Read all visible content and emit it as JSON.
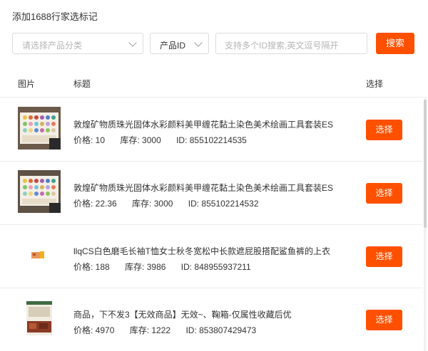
{
  "page_title": "添加1688行家选标记",
  "filters": {
    "category_placeholder": "请选择产品分类",
    "id_type_value": "产品ID",
    "search_placeholder": "支持多个ID搜索,英文逗号隔开",
    "search_button": "搜索"
  },
  "table": {
    "headers": {
      "image": "图片",
      "title": "标题",
      "action": "选择"
    },
    "rows": [
      {
        "title": "敦煌矿物质珠光固体水彩颜料美甲缠花黏土染色美术绘画工具套装ES",
        "price": "价格:  10",
        "stock": "库存:  3000",
        "id": "ID:  855102214535",
        "button": "选择",
        "thumb_icon": "watercolor-set-thumbnail"
      },
      {
        "title": "敦煌矿物质珠光固体水彩颜料美甲缠花黏土染色美术绘画工具套装ES",
        "price": "价格:  22.36",
        "stock": "库存:  3000",
        "id": "ID:  855102214532",
        "button": "选择",
        "thumb_icon": "watercolor-set-thumbnail"
      },
      {
        "title": "llqCS白色磨毛长袖T恤女士秋冬宽松中长款遮屁股搭配鲨鱼裤的上衣",
        "price": "价格:  188",
        "stock": "库存:  3986",
        "id": "ID:  848955937211",
        "button": "选择",
        "thumb_icon": "small-product-thumbnail"
      },
      {
        "title": "商品，下不发3【无效商品】无效~、鞠箱-仅属性收藏后优",
        "price": "价格:  4970",
        "stock": "库存:  1222",
        "id": "ID:  853807429473",
        "button": "选择",
        "thumb_icon": "product-box-thumbnail"
      }
    ]
  },
  "colors": {
    "accent": "#ff5000",
    "border": "#dcdcdc",
    "divider": "#ececec"
  }
}
